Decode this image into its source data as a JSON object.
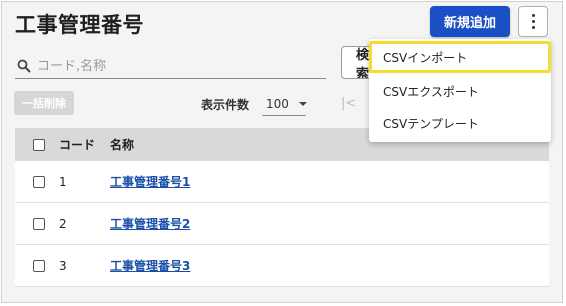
{
  "header": {
    "title": "工事管理番号",
    "add_button": "新規追加"
  },
  "search": {
    "placeholder": "コード,名称",
    "button_label": "検索"
  },
  "toolbar": {
    "bulk_delete": "一括削除",
    "per_page_label": "表示件数",
    "per_page_value": "100",
    "first_page_symbol": "|<"
  },
  "table": {
    "columns": [
      "コード",
      "名称"
    ],
    "rows": [
      {
        "code": "1",
        "name": "工事管理番号1"
      },
      {
        "code": "2",
        "name": "工事管理番号2"
      },
      {
        "code": "3",
        "name": "工事管理番号3"
      }
    ]
  },
  "menu": {
    "items": [
      "CSVインポート",
      "CSVエクスポート",
      "CSVテンプレート"
    ],
    "highlighted_index": 0,
    "highlight_color": "#f5dd30"
  },
  "colors": {
    "primary": "#1b4fc4",
    "link": "#1a4fa8"
  }
}
